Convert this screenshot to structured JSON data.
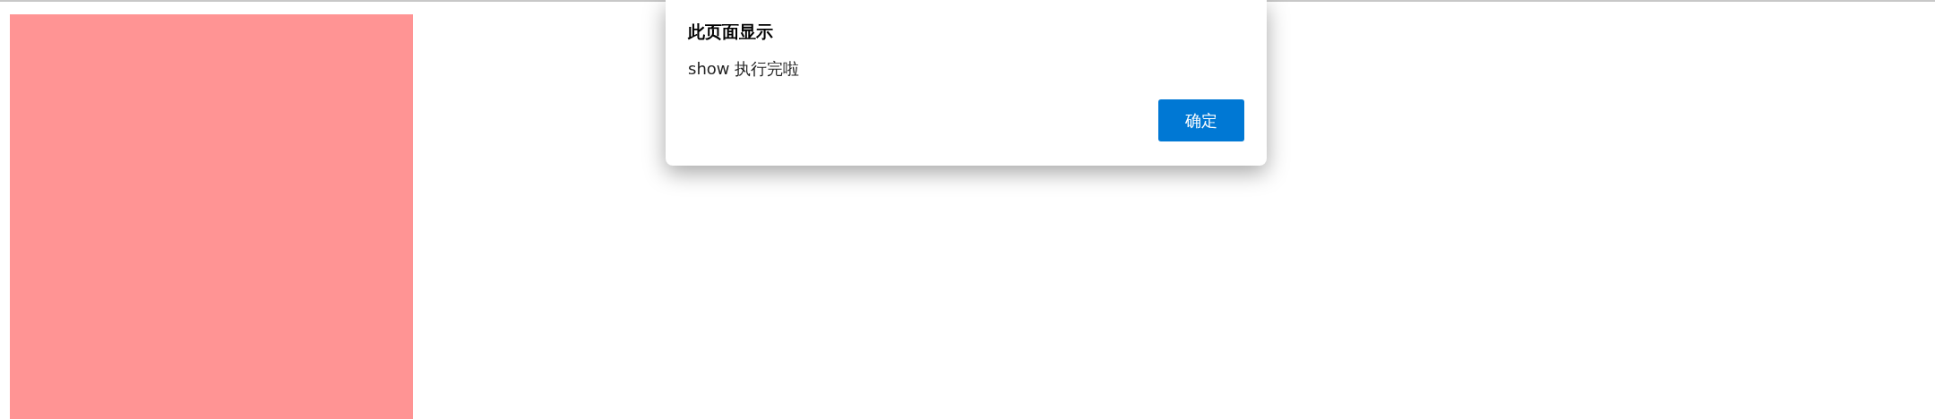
{
  "page": {
    "box": {
      "color": "#ff9494"
    }
  },
  "dialog": {
    "title": "此页面显示",
    "message": "show 执行完啦",
    "buttons": [
      "确定"
    ]
  }
}
